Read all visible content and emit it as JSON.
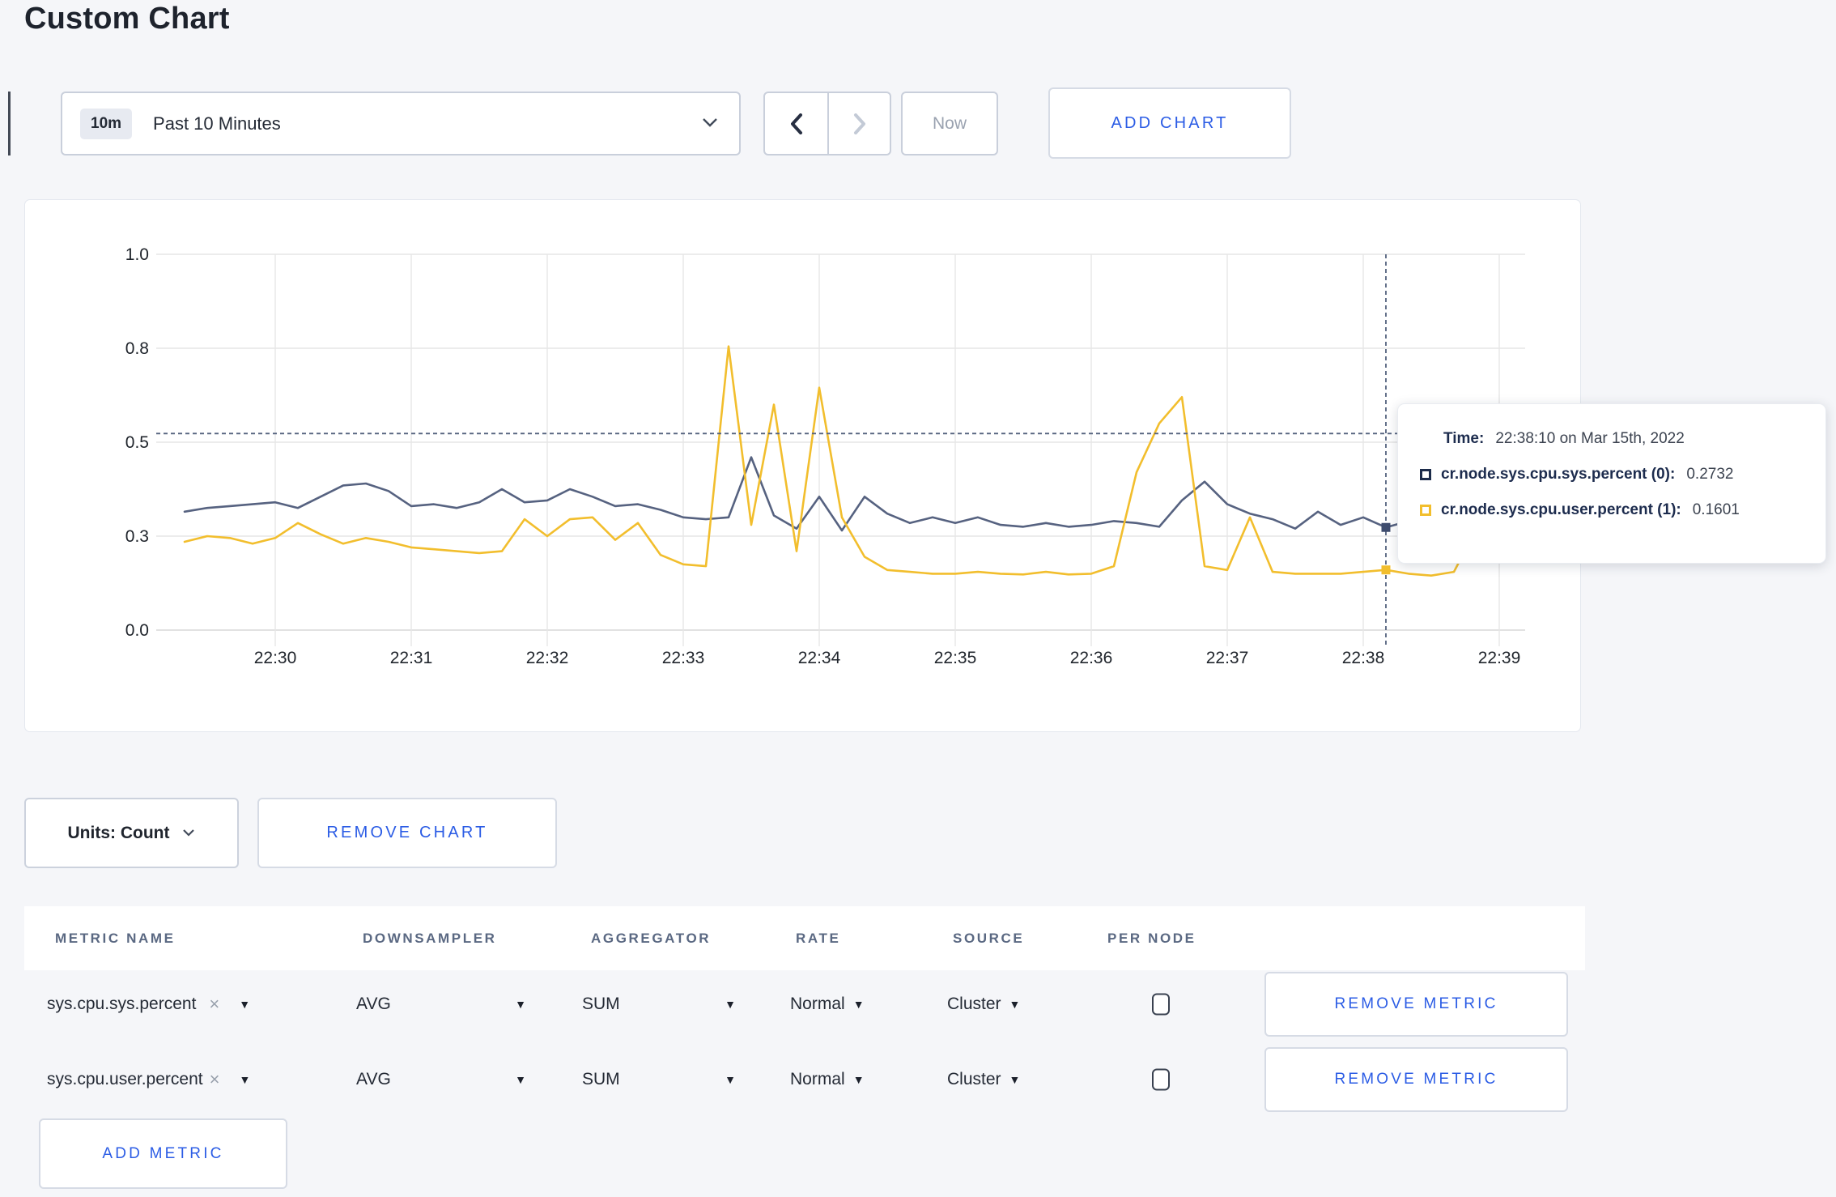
{
  "page": {
    "title": "Custom Chart"
  },
  "toolbar": {
    "time_range": {
      "badge": "10m",
      "label": "Past 10 Minutes"
    },
    "now_label": "Now",
    "add_chart_label": "ADD CHART"
  },
  "chart_data": {
    "type": "line",
    "title": "",
    "xlabel": "",
    "ylabel": "",
    "x_ticks": [
      "22:30",
      "22:31",
      "22:32",
      "22:33",
      "22:34",
      "22:35",
      "22:36",
      "22:37",
      "22:38",
      "22:39"
    ],
    "x_start": "22:29:20",
    "x_step_seconds": 10,
    "ylim": [
      0,
      1.0
    ],
    "y_ticks": [
      {
        "label": "0.0",
        "pos": 0.0
      },
      {
        "label": "0.3",
        "pos": 0.25
      },
      {
        "label": "0.5",
        "pos": 0.5
      },
      {
        "label": "0.8",
        "pos": 0.75
      },
      {
        "label": "1.0",
        "pos": 1.0
      }
    ],
    "grid": true,
    "series": [
      {
        "name": "cr.node.sys.cpu.sys.percent (0)",
        "color": "#566280",
        "dot_color": "#3e4c6e",
        "values": [
          0.315,
          0.325,
          0.33,
          0.335,
          0.34,
          0.325,
          0.355,
          0.385,
          0.39,
          0.37,
          0.33,
          0.335,
          0.325,
          0.34,
          0.375,
          0.34,
          0.345,
          0.375,
          0.355,
          0.33,
          0.335,
          0.32,
          0.3,
          0.295,
          0.3,
          0.46,
          0.305,
          0.27,
          0.355,
          0.265,
          0.355,
          0.31,
          0.285,
          0.3,
          0.285,
          0.3,
          0.28,
          0.275,
          0.285,
          0.275,
          0.28,
          0.29,
          0.285,
          0.275,
          0.345,
          0.395,
          0.335,
          0.31,
          0.295,
          0.27,
          0.315,
          0.28,
          0.3,
          0.2732,
          0.29,
          0.302,
          0.288,
          0.3,
          0.295,
          0.3
        ]
      },
      {
        "name": "cr.node.sys.cpu.user.percent (1)",
        "color": "#f2be2d",
        "dot_color": "#f2be2d",
        "values": [
          0.235,
          0.25,
          0.245,
          0.23,
          0.245,
          0.285,
          0.255,
          0.23,
          0.245,
          0.235,
          0.22,
          0.215,
          0.21,
          0.205,
          0.21,
          0.295,
          0.25,
          0.295,
          0.3,
          0.24,
          0.285,
          0.2,
          0.175,
          0.17,
          0.755,
          0.28,
          0.6,
          0.21,
          0.645,
          0.3,
          0.195,
          0.16,
          0.155,
          0.15,
          0.15,
          0.155,
          0.15,
          0.148,
          0.155,
          0.148,
          0.15,
          0.17,
          0.42,
          0.55,
          0.62,
          0.17,
          0.16,
          0.3,
          0.155,
          0.15,
          0.15,
          0.15,
          0.155,
          0.1601,
          0.15,
          0.145,
          0.155,
          0.27,
          0.3,
          0.24
        ]
      }
    ],
    "crosshair": {
      "x_index": 53,
      "hover_value": 0.523
    },
    "colors": {
      "grid": "#e6e6e6",
      "baseline": "#d9d9d9",
      "crosshair": "#54627e",
      "tick_text": "#20252c"
    }
  },
  "tooltip": {
    "time_label": "Time:",
    "time_value": "22:38:10 on Mar 15th, 2022",
    "rows": [
      {
        "label": "cr.node.sys.cpu.sys.percent (0):",
        "value": "0.2732",
        "color": "#1c2b4a"
      },
      {
        "label": "cr.node.sys.cpu.user.percent (1):",
        "value": "0.1601",
        "color": "#f2be2d"
      }
    ]
  },
  "chart_controls": {
    "units_label": "Units: Count",
    "remove_chart_label": "REMOVE CHART"
  },
  "metrics_table": {
    "headers": [
      "METRIC NAME",
      "DOWNSAMPLER",
      "AGGREGATOR",
      "RATE",
      "SOURCE",
      "PER NODE"
    ],
    "remove_icon": "×",
    "rows": [
      {
        "metric": "sys.cpu.sys.percent",
        "downsampler": "AVG",
        "aggregator": "SUM",
        "rate": "Normal",
        "source": "Cluster",
        "per_node": false,
        "remove_label": "REMOVE METRIC"
      },
      {
        "metric": "sys.cpu.user.percent",
        "downsampler": "AVG",
        "aggregator": "SUM",
        "rate": "Normal",
        "source": "Cluster",
        "per_node": false,
        "remove_label": "REMOVE METRIC"
      }
    ],
    "add_metric_label": "ADD METRIC"
  }
}
